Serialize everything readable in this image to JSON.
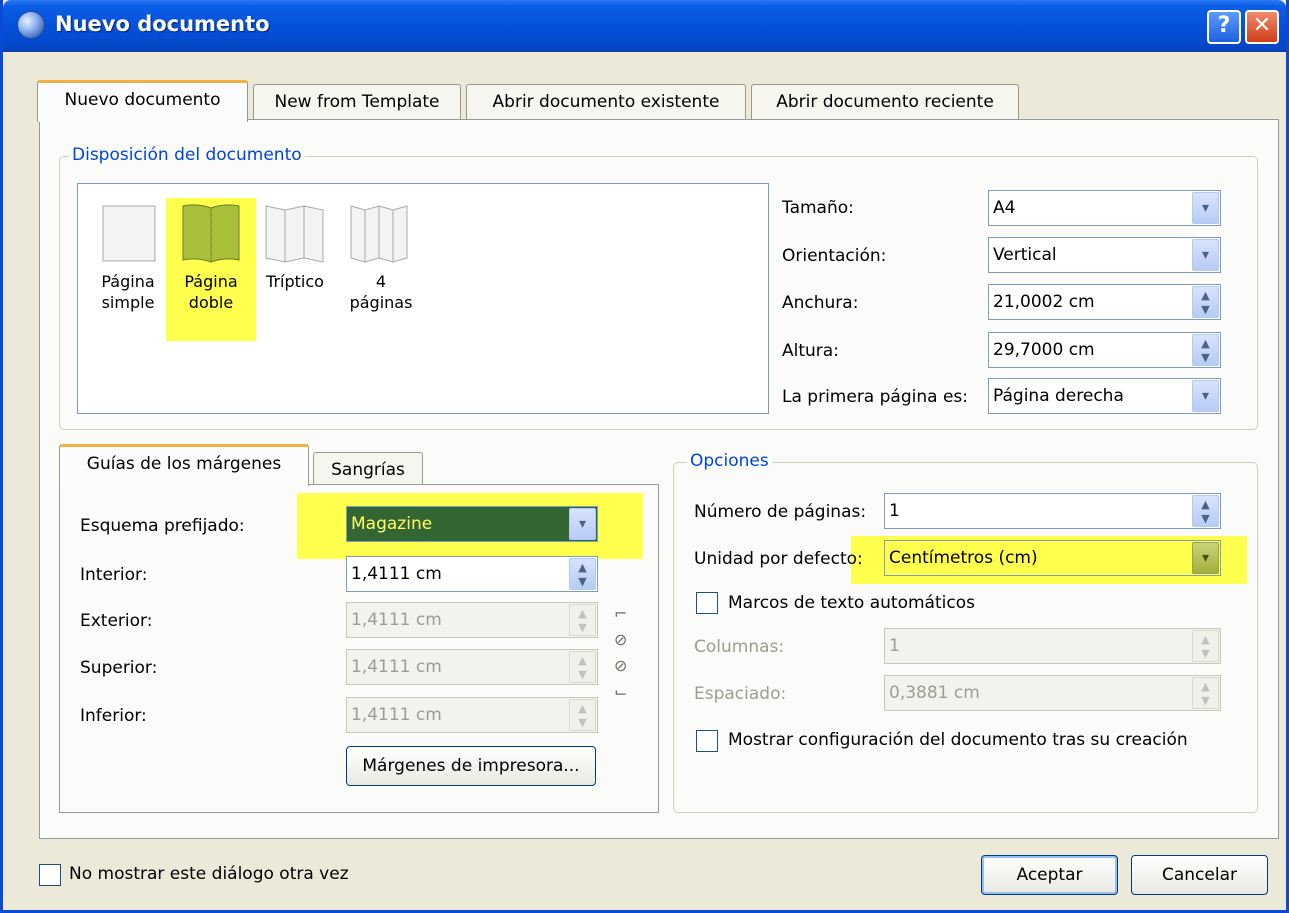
{
  "window": {
    "title": "Nuevo documento",
    "help_glyph": "?",
    "close_glyph": "✕"
  },
  "tabs": [
    {
      "label": "Nuevo documento"
    },
    {
      "label": "New from Template"
    },
    {
      "label": "Abrir documento existente"
    },
    {
      "label": "Abrir documento reciente"
    }
  ],
  "layout_group": {
    "title": "Disposición del documento",
    "options": [
      {
        "line1": "Página",
        "line2": "simple",
        "icon": "single-page-icon"
      },
      {
        "line1": "Página",
        "line2": "doble",
        "icon": "double-page-icon",
        "selected": true
      },
      {
        "line1": "Tríptico",
        "line2": "",
        "icon": "triptych-icon"
      },
      {
        "line1": "4",
        "line2": "páginas",
        "icon": "four-pages-icon"
      }
    ],
    "size_label": "Tamaño:",
    "size_value": "A4",
    "orientation_label": "Orientación:",
    "orientation_value": "Vertical",
    "width_label": "Anchura:",
    "width_value": "21,0002 cm",
    "height_label": "Altura:",
    "height_value": "29,7000 cm",
    "first_page_label": "La primera página es:",
    "first_page_value": "Página derecha"
  },
  "margins": {
    "tab_active": "Guías de los márgenes",
    "tab_other": "Sangrías",
    "preset_label": "Esquema prefijado:",
    "preset_value": "Magazine",
    "inner_label": "Interior:",
    "inner_value": "1,4111 cm",
    "outer_label": "Exterior:",
    "outer_value": "1,4111 cm",
    "top_label": "Superior:",
    "top_value": "1,4111 cm",
    "bottom_label": "Inferior:",
    "bottom_value": "1,4111 cm",
    "printer_button": "Márgenes de impresora..."
  },
  "options": {
    "title": "Opciones",
    "pages_label": "Número de páginas:",
    "pages_value": "1",
    "unit_label": "Unidad por defecto:",
    "unit_value": "Centímetros (cm)",
    "auto_frames_label": "Marcos de texto automáticos",
    "columns_label": "Columnas:",
    "columns_value": "1",
    "spacing_label": "Espaciado:",
    "spacing_value": "0,3881 cm",
    "show_settings_label": "Mostrar configuración del documento tras su creación"
  },
  "footer": {
    "dont_show_label": "No mostrar este diálogo otra vez",
    "ok_button": "Aceptar",
    "cancel_button": "Cancelar"
  },
  "colors": {
    "highlight": "#ffff4d",
    "titlebar": "#0551dc",
    "group_title": "#0046d5",
    "preset_fill": "#336633"
  }
}
